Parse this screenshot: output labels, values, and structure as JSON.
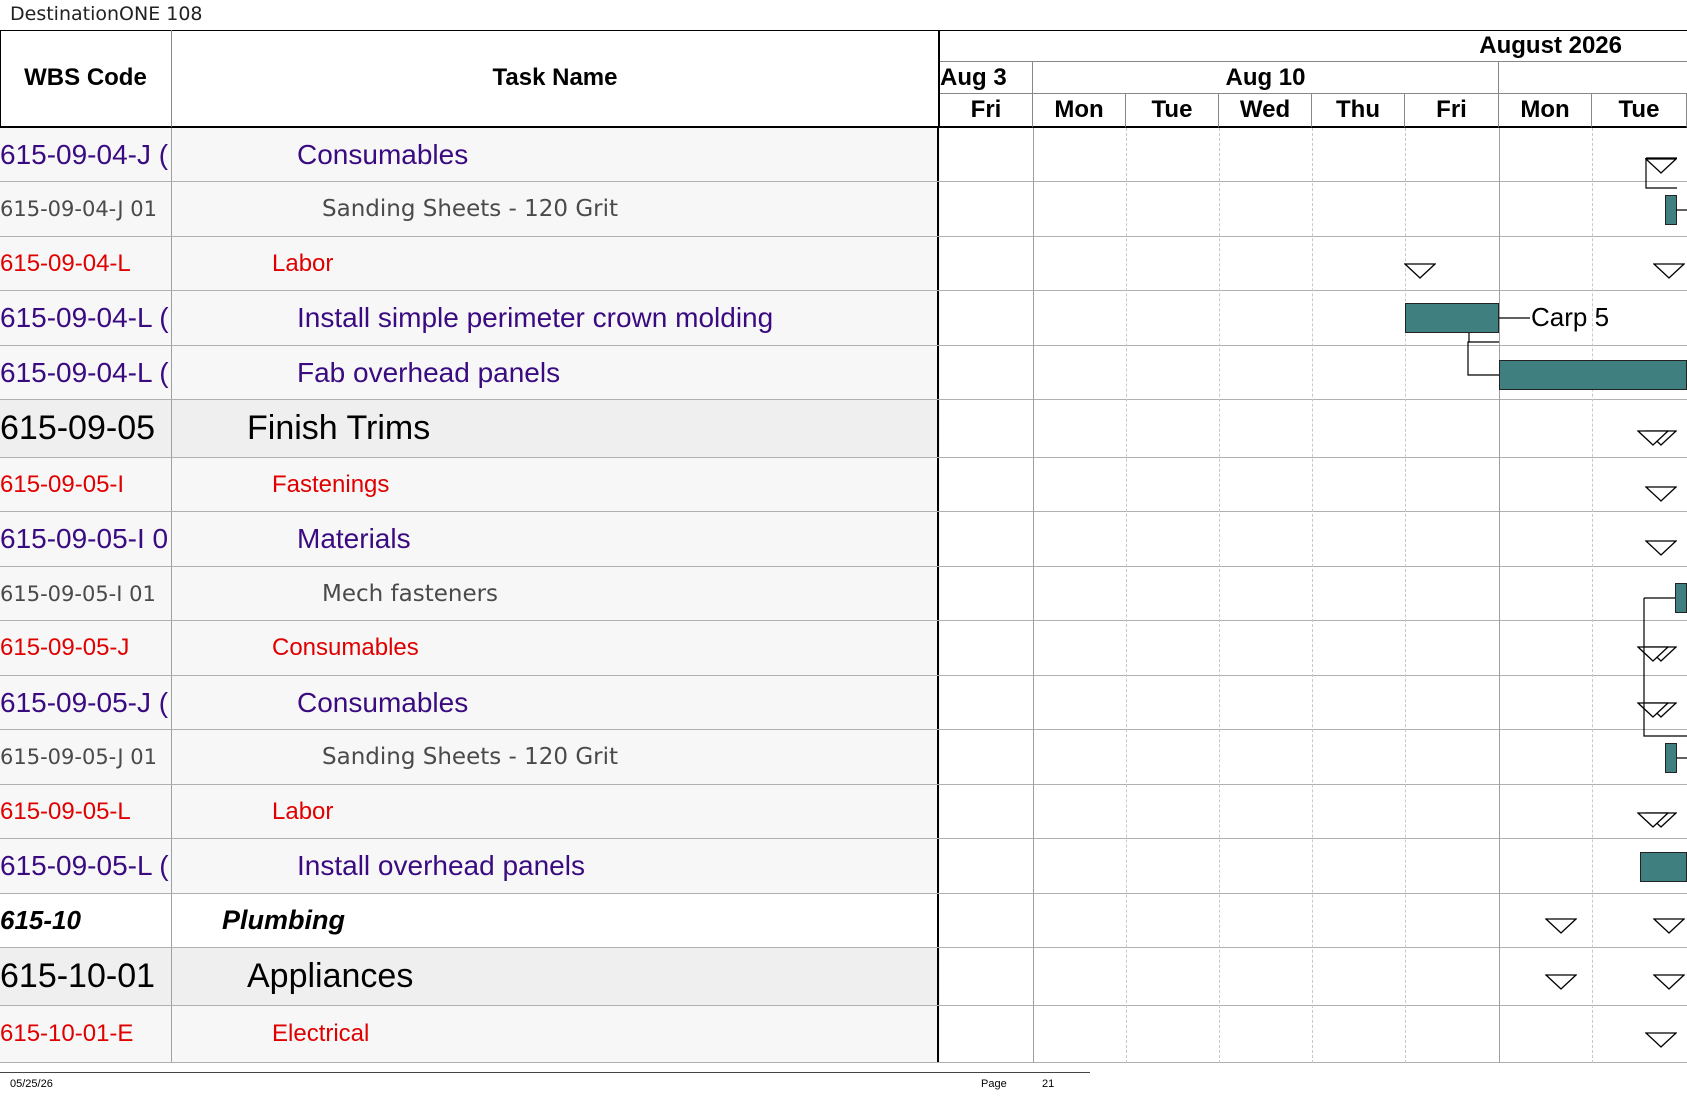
{
  "document": {
    "title": "DestinationONE 108"
  },
  "table_header": {
    "wbs_label": "WBS Code",
    "task_label": "Task Name"
  },
  "timeline": {
    "month": "August 2026",
    "weeks": [
      "Aug 3",
      "Aug 10"
    ],
    "days": [
      "Fri",
      "Mon",
      "Tue",
      "Wed",
      "Thu",
      "Fri",
      "Mon",
      "Tue"
    ]
  },
  "rows": [
    {
      "wbs": "615-09-04-J (",
      "task": "Consumables",
      "level": 4
    },
    {
      "wbs": "615-09-04-J 01",
      "task": "Sanding Sheets - 120 Grit",
      "level": 5
    },
    {
      "wbs": "615-09-04-L",
      "task": "Labor",
      "level": 3
    },
    {
      "wbs": "615-09-04-L (",
      "task": "Install simple perimeter crown molding",
      "level": 4
    },
    {
      "wbs": "615-09-04-L (",
      "task": "Fab overhead panels",
      "level": 4
    },
    {
      "wbs": "615-09-05",
      "task": "Finish Trims",
      "level": 2
    },
    {
      "wbs": "615-09-05-I",
      "task": "Fastenings",
      "level": 3
    },
    {
      "wbs": "615-09-05-I 0",
      "task": "Materials",
      "level": 4
    },
    {
      "wbs": "615-09-05-I 01",
      "task": "Mech fasteners",
      "level": 5
    },
    {
      "wbs": "615-09-05-J",
      "task": "Consumables",
      "level": 3
    },
    {
      "wbs": "615-09-05-J (",
      "task": "Consumables",
      "level": 4
    },
    {
      "wbs": "615-09-05-J 01",
      "task": "Sanding Sheets - 120 Grit",
      "level": 5
    },
    {
      "wbs": "615-09-05-L",
      "task": "Labor",
      "level": 3
    },
    {
      "wbs": "615-09-05-L (",
      "task": "Install overhead panels",
      "level": 4
    },
    {
      "wbs": "615-10",
      "task": "Plumbing",
      "level": 1
    },
    {
      "wbs": "615-10-01",
      "task": "Appliances",
      "level": 2
    },
    {
      "wbs": "615-10-01-E",
      "task": "Electrical",
      "level": 3
    }
  ],
  "gantt_labels": {
    "resource_label": "Carp 5"
  },
  "footer": {
    "date": "05/25/26",
    "page_label": "Page",
    "page_number": "21"
  },
  "colors": {
    "level1": "#000000",
    "level2": "#000000",
    "level3": "#e00000",
    "level4": "#3a0a80",
    "level5": "#4a4a4a",
    "bar": "#3f7f7f",
    "summary_bg": "#efefef"
  }
}
